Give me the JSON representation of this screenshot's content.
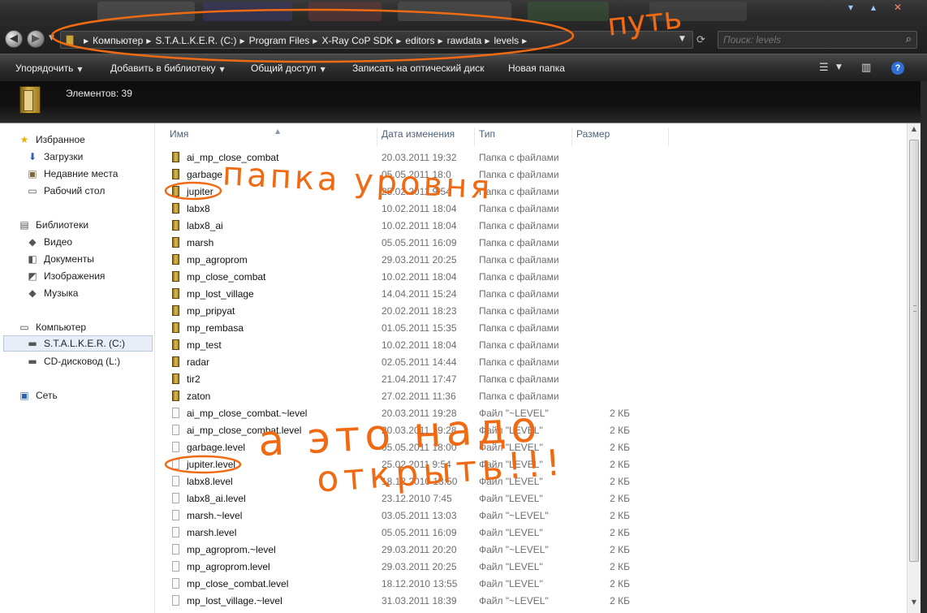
{
  "window": {
    "min_glyph": "▾",
    "max_glyph": "▴",
    "close_glyph": "✕"
  },
  "address": {
    "crumbs": [
      "Компьютер",
      "S.T.A.L.K.E.R. (C:)",
      "Program Files",
      "X-Ray CoP SDK",
      "editors",
      "rawdata",
      "levels"
    ],
    "search_placeholder": "Поиск: levels"
  },
  "toolbar": {
    "organize": "Упорядочить",
    "add_library": "Добавить в библиотеку",
    "share": "Общий доступ",
    "burn": "Записать на оптический диск",
    "new_folder": "Новая папка",
    "help": "?"
  },
  "details": {
    "count_label": "Элементов: 39"
  },
  "nav": {
    "favorites": "Избранное",
    "downloads": "Загрузки",
    "recent": "Недавние места",
    "desktop": "Рабочий стол",
    "libraries": "Библиотеки",
    "video": "Видео",
    "documents": "Документы",
    "images": "Изображения",
    "music": "Музыка",
    "computer": "Компьютер",
    "drive_c": "S.T.A.L.K.E.R. (C:)",
    "drive_l": "CD-дисковод (L:)",
    "network": "Сеть"
  },
  "columns": {
    "name": "Имя",
    "date": "Дата изменения",
    "type": "Тип",
    "size": "Размер"
  },
  "files": [
    {
      "name": "ai_mp_close_combat",
      "date": "20.03.2011 19:32",
      "type": "Папка с файлами",
      "size": "",
      "kind": "folder"
    },
    {
      "name": "garbage",
      "date": "05.05.2011 18:0",
      "type": "Папка с файлами",
      "size": "",
      "kind": "folder"
    },
    {
      "name": "jupiter",
      "date": "25.02.2011 9:54",
      "type": "Папка с файлами",
      "size": "",
      "kind": "folder"
    },
    {
      "name": "labx8",
      "date": "10.02.2011 18:04",
      "type": "Папка с файлами",
      "size": "",
      "kind": "folder"
    },
    {
      "name": "labx8_ai",
      "date": "10.02.2011 18:04",
      "type": "Папка с файлами",
      "size": "",
      "kind": "folder"
    },
    {
      "name": "marsh",
      "date": "05.05.2011 16:09",
      "type": "Папка с файлами",
      "size": "",
      "kind": "folder"
    },
    {
      "name": "mp_agroprom",
      "date": "29.03.2011 20:25",
      "type": "Папка с файлами",
      "size": "",
      "kind": "folder"
    },
    {
      "name": "mp_close_combat",
      "date": "10.02.2011 18:04",
      "type": "Папка с файлами",
      "size": "",
      "kind": "folder"
    },
    {
      "name": "mp_lost_village",
      "date": "14.04.2011 15:24",
      "type": "Папка с файлами",
      "size": "",
      "kind": "folder"
    },
    {
      "name": "mp_pripyat",
      "date": "20.02.2011 18:23",
      "type": "Папка с файлами",
      "size": "",
      "kind": "folder"
    },
    {
      "name": "mp_rembasa",
      "date": "01.05.2011 15:35",
      "type": "Папка с файлами",
      "size": "",
      "kind": "folder"
    },
    {
      "name": "mp_test",
      "date": "10.02.2011 18:04",
      "type": "Папка с файлами",
      "size": "",
      "kind": "folder"
    },
    {
      "name": "radar",
      "date": "02.05.2011 14:44",
      "type": "Папка с файлами",
      "size": "",
      "kind": "folder"
    },
    {
      "name": "tir2",
      "date": "21.04.2011 17:47",
      "type": "Папка с файлами",
      "size": "",
      "kind": "folder"
    },
    {
      "name": "zaton",
      "date": "27.02.2011 11:36",
      "type": "Папка с файлами",
      "size": "",
      "kind": "folder"
    },
    {
      "name": "ai_mp_close_combat.~level",
      "date": "20.03.2011 19:28",
      "type": "Файл \"~LEVEL\"",
      "size": "2 КБ",
      "kind": "file"
    },
    {
      "name": "ai_mp_close_combat.level",
      "date": "20.03.2011 19:28",
      "type": "Файл \"LEVEL\"",
      "size": "2 КБ",
      "kind": "file"
    },
    {
      "name": "garbage.level",
      "date": "05.05.2011 18:00",
      "type": "Файл \"LEVEL\"",
      "size": "2 КБ",
      "kind": "file"
    },
    {
      "name": "jupiter.level",
      "date": "25.02.2011 9:54",
      "type": "Файл \"LEVEL\"",
      "size": "2 КБ",
      "kind": "file"
    },
    {
      "name": "labx8.level",
      "date": "18.12.2010 13:50",
      "type": "Файл \"LEVEL\"",
      "size": "2 КБ",
      "kind": "file"
    },
    {
      "name": "labx8_ai.level",
      "date": "23.12.2010 7:45",
      "type": "Файл \"LEVEL\"",
      "size": "2 КБ",
      "kind": "file"
    },
    {
      "name": "marsh.~level",
      "date": "03.05.2011 13:03",
      "type": "Файл \"~LEVEL\"",
      "size": "2 КБ",
      "kind": "file"
    },
    {
      "name": "marsh.level",
      "date": "05.05.2011 16:09",
      "type": "Файл \"LEVEL\"",
      "size": "2 КБ",
      "kind": "file"
    },
    {
      "name": "mp_agroprom.~level",
      "date": "29.03.2011 20:20",
      "type": "Файл \"~LEVEL\"",
      "size": "2 КБ",
      "kind": "file"
    },
    {
      "name": "mp_agroprom.level",
      "date": "29.03.2011 20:25",
      "type": "Файл \"LEVEL\"",
      "size": "2 КБ",
      "kind": "file"
    },
    {
      "name": "mp_close_combat.level",
      "date": "18.12.2010 13:55",
      "type": "Файл \"LEVEL\"",
      "size": "2 КБ",
      "kind": "file"
    },
    {
      "name": "mp_lost_village.~level",
      "date": "31.03.2011 18:39",
      "type": "Файл \"~LEVEL\"",
      "size": "2 КБ",
      "kind": "file"
    }
  ],
  "annotations": {
    "path_note": "путь",
    "folder_note": "папка уровня",
    "file_note_1": "а это надо",
    "file_note_2": "открыть!!!",
    "color": "#f06a14"
  },
  "icons": {
    "back": "back-arrow-icon",
    "forward": "forward-arrow-icon",
    "search": "search-icon",
    "help": "help-icon"
  }
}
